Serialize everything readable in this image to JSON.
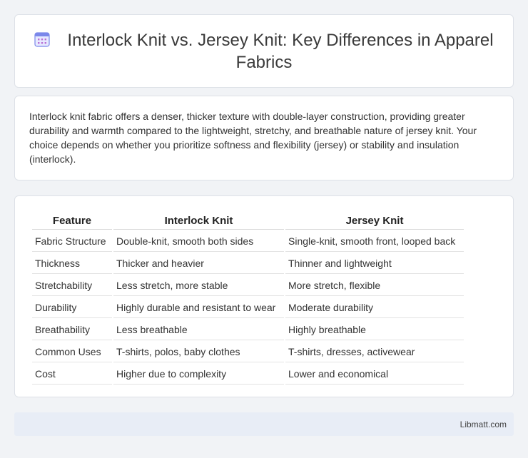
{
  "header": {
    "title": "Interlock Knit vs. Jersey Knit: Key Differences in Apparel Fabrics",
    "icon": "calendar-icon",
    "icon_color": "#6f7fe8"
  },
  "summary": {
    "text": "Interlock knit fabric offers a denser, thicker texture with double-layer construction, providing greater durability and warmth compared to the lightweight, stretchy, and breathable nature of jersey knit. Your choice depends on whether you prioritize softness and flexibility (jersey) or stability and insulation (interlock)."
  },
  "table": {
    "headers": [
      "Feature",
      "Interlock Knit",
      "Jersey Knit"
    ],
    "rows": [
      [
        "Fabric Structure",
        "Double-knit, smooth both sides",
        "Single-knit, smooth front, looped back"
      ],
      [
        "Thickness",
        "Thicker and heavier",
        "Thinner and lightweight"
      ],
      [
        "Stretchability",
        "Less stretch, more stable",
        "More stretch, flexible"
      ],
      [
        "Durability",
        "Highly durable and resistant to wear",
        "Moderate durability"
      ],
      [
        "Breathability",
        "Less breathable",
        "Highly breathable"
      ],
      [
        "Common Uses",
        "T-shirts, polos, baby clothes",
        "T-shirts, dresses, activewear"
      ],
      [
        "Cost",
        "Higher due to complexity",
        "Lower and economical"
      ]
    ]
  },
  "footer": {
    "site": "Libmatt.com"
  }
}
